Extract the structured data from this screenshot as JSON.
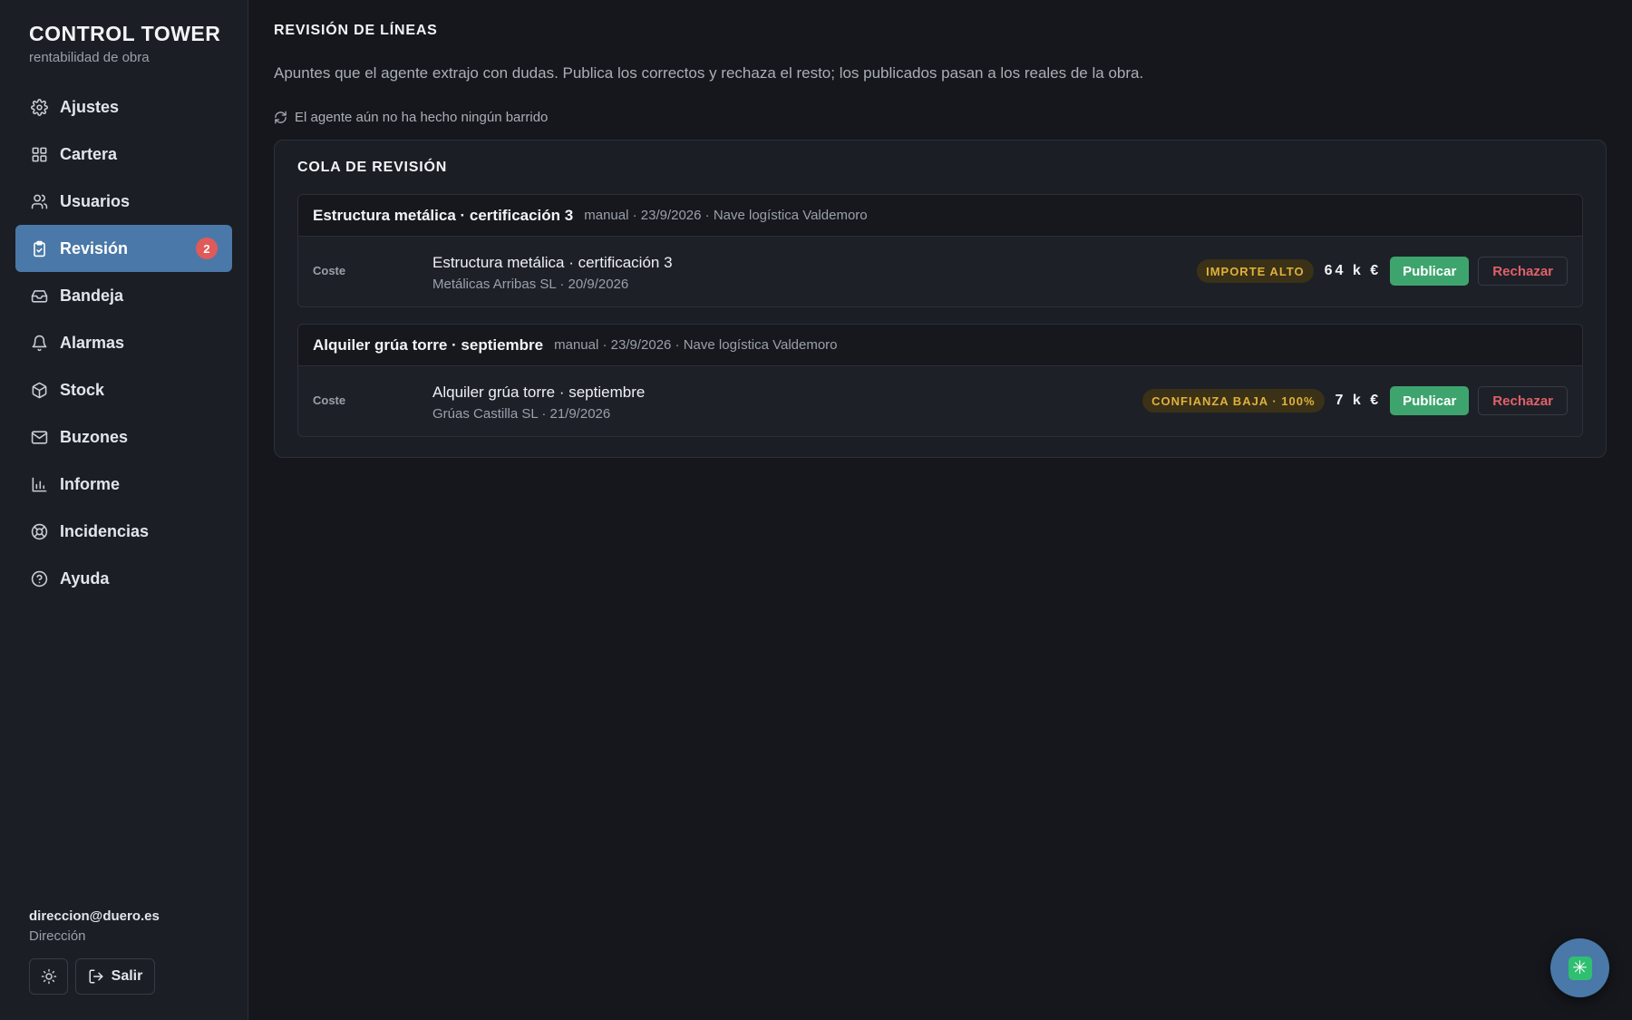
{
  "brand": {
    "title": "CONTROL TOWER",
    "subtitle": "rentabilidad de obra"
  },
  "sidebar": {
    "items": [
      {
        "label": "Ajustes",
        "icon": "gear-icon"
      },
      {
        "label": "Cartera",
        "icon": "grid-icon"
      },
      {
        "label": "Usuarios",
        "icon": "users-icon"
      },
      {
        "label": "Revisión",
        "icon": "clipboard-check-icon",
        "badge": "2",
        "active": true
      },
      {
        "label": "Bandeja",
        "icon": "inbox-icon"
      },
      {
        "label": "Alarmas",
        "icon": "bell-icon"
      },
      {
        "label": "Stock",
        "icon": "package-icon"
      },
      {
        "label": "Buzones",
        "icon": "mail-icon"
      },
      {
        "label": "Informe",
        "icon": "bar-chart-icon"
      },
      {
        "label": "Incidencias",
        "icon": "lifebuoy-icon"
      },
      {
        "label": "Ayuda",
        "icon": "help-circle-icon"
      }
    ]
  },
  "user": {
    "email": "direccion@duero.es",
    "role": "Dirección",
    "logout_label": "Salir"
  },
  "main": {
    "title": "REVISIÓN DE LÍNEAS",
    "description": "Apuntes que el agente extrajo con dudas. Publica los correctos y rechaza el resto; los publicados pasan a los reales de la obra.",
    "agent_status": "El agente aún no ha hecho ningún barrido",
    "queue_title": "COLA DE REVISIÓN",
    "cards": [
      {
        "title": "Estructura metálica · certificación 3",
        "meta": "manual · 23/9/2026 · Nave logística Valdemoro",
        "kind": "Coste",
        "line_title": "Estructura metálica · certificación 3",
        "line_sub": "Metálicas Arribas SL · 20/9/2026",
        "tag": "IMPORTE ALTO",
        "amount": "64 k €",
        "publish_label": "Publicar",
        "reject_label": "Rechazar"
      },
      {
        "title": "Alquiler grúa torre · septiembre",
        "meta": "manual · 23/9/2026 · Nave logística Valdemoro",
        "kind": "Coste",
        "line_title": "Alquiler grúa torre · septiembre",
        "line_sub": "Grúas Castilla SL · 21/9/2026",
        "tag": "CONFIANZA BAJA · 100%",
        "amount": "7 k €",
        "publish_label": "Publicar",
        "reject_label": "Rechazar"
      }
    ]
  },
  "colors": {
    "accent": "#4a78a8",
    "publish": "#3ea46e",
    "reject": "#e0606a",
    "warning": "#e0b13a",
    "badge": "#e05a5a"
  }
}
